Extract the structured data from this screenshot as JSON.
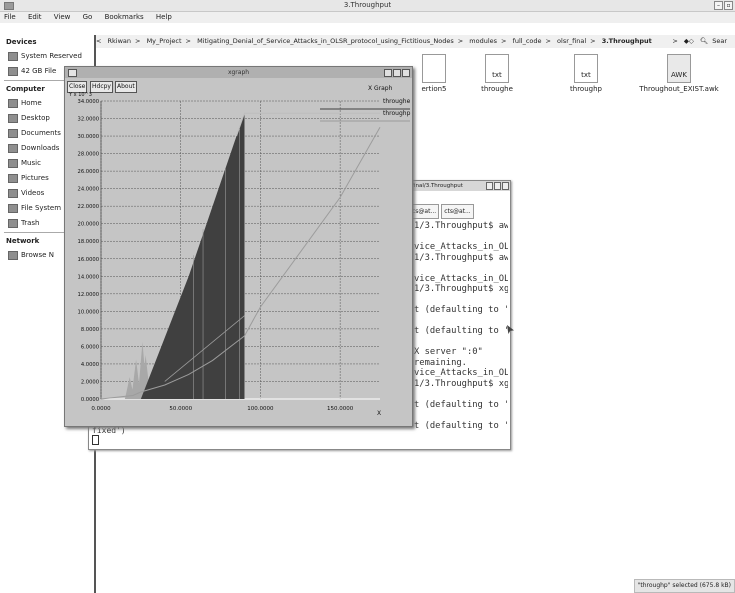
{
  "window": {
    "title": "3.Throughput"
  },
  "menu": [
    "File",
    "Edit",
    "View",
    "Go",
    "Bookmarks",
    "Help"
  ],
  "sidebar": {
    "devices_header": "Devices",
    "devices": [
      "System Reserved",
      "42 GB File"
    ],
    "computer_header": "Computer",
    "computer": [
      "Home",
      "Desktop",
      "Documents",
      "Downloads",
      "Music",
      "Pictures",
      "Videos",
      "File System",
      "Trash"
    ],
    "network_header": "Network",
    "network": [
      "Browse N"
    ]
  },
  "pathbar": {
    "crumbs": [
      "Rkiwan",
      "My_Project",
      "Mitigating_Denial_of_Service_Attacks_in_OLSR_protocol_using_Fictitious_Nodes",
      "modules",
      "full_code",
      "olsr_final"
    ],
    "current": "3.Throughput",
    "search": "Sear"
  },
  "files": [
    {
      "name": "ertion5",
      "type": ""
    },
    {
      "name": "throughe",
      "type": "txt"
    },
    {
      "name": "throughp",
      "type": "txt"
    },
    {
      "name": "Throughout_EXIST.awk",
      "type": "AWK"
    }
  ],
  "terminal": {
    "title": "final/3.Throughput",
    "tabs": [
      "cs@at...",
      "cts@at..."
    ],
    "lines": [
      "1/3.Throughput$ aw",
      "",
      "vice_Attacks_in_OL",
      "1/3.Throughput$ aw",
      "",
      "vice_Attacks_in_OL",
      "1/3.Throughput$ xg",
      "",
      "t (defaulting to '",
      "",
      "t (defaulting to '",
      "",
      "X server \":0\"",
      "remaining.",
      "vice_Attacks_in_OL",
      "1/3.Throughput$ xg",
      "",
      "t (defaulting to '",
      "",
      "t (defaulting to '"
    ],
    "tail": "fixed')"
  },
  "xgraph": {
    "title": "xgraph",
    "buttons": [
      "Close",
      "Hdcpy",
      "About"
    ],
    "x_graph_label": "X Graph",
    "y_unit_label": "Y x 10^3",
    "legend": [
      "throughe",
      "throughp"
    ],
    "x_axis_label": "X",
    "y_ticks": [
      "0.0000",
      "2.0000",
      "4.0000",
      "6.0000",
      "8.0000",
      "10.0000",
      "12.0000",
      "14.0000",
      "16.0000",
      "18.0000",
      "20.0000",
      "22.0000",
      "24.0000",
      "26.0000",
      "28.0000",
      "30.0000",
      "32.0000",
      "34.0000"
    ],
    "x_ticks": [
      "0.0000",
      "50.0000",
      "100.0000",
      "150.0000"
    ]
  },
  "chart_data": {
    "type": "line",
    "x": [
      0,
      20,
      25,
      40,
      55,
      70,
      85,
      90,
      100,
      150,
      175
    ],
    "ylim": [
      0,
      34
    ],
    "xlim": [
      0,
      175
    ],
    "series": [
      {
        "name": "throughe",
        "values": [
          0,
          0,
          0,
          7,
          14,
          22,
          30,
          32.6,
          32.6,
          32.6,
          32.6
        ]
      },
      {
        "name": "throughp",
        "values": [
          0,
          0.4,
          0.8,
          1.6,
          2.8,
          4.4,
          6.5,
          7.2,
          10.5,
          23,
          31
        ]
      }
    ],
    "colors": {
      "throughe": "#404040",
      "throughp": "#9c9c9c",
      "early_spike": "#a8a8a8"
    }
  },
  "status": "\"throughp\" selected (675.8 kB)"
}
